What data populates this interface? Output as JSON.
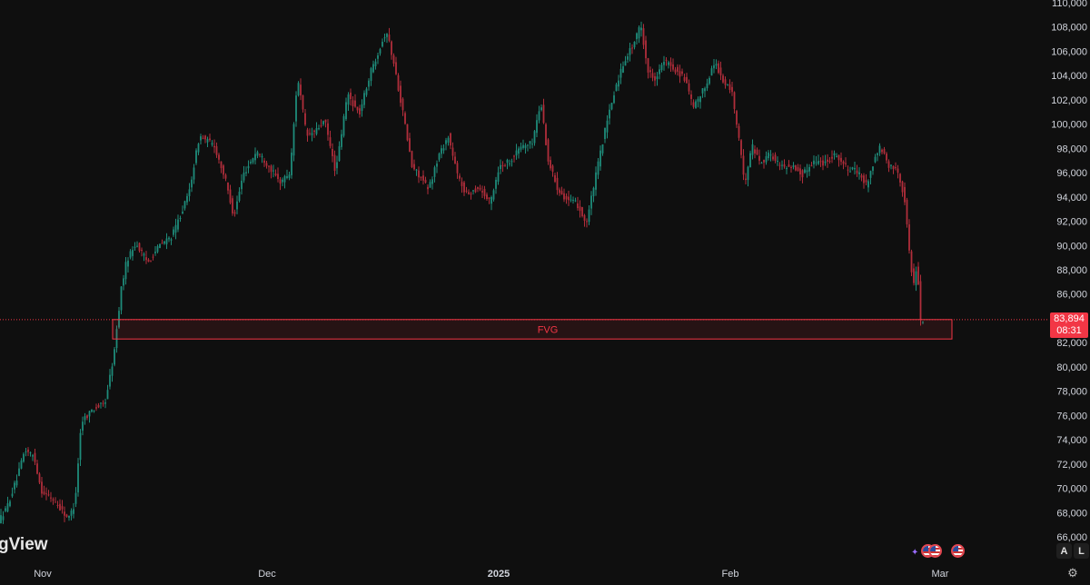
{
  "chart_data": {
    "type": "candlestick",
    "y_axis": {
      "min": 66000,
      "max": 110000,
      "ticks": [
        "110,000",
        "108,000",
        "106,000",
        "104,000",
        "102,000",
        "100,000",
        "98,000",
        "96,000",
        "94,000",
        "92,000",
        "90,000",
        "88,000",
        "86,000",
        "82,000",
        "80,000",
        "78,000",
        "76,000",
        "74,000",
        "72,000",
        "70,000",
        "68,000",
        "66,000"
      ]
    },
    "x_axis": {
      "ticks": [
        {
          "label": "Nov",
          "bold": false
        },
        {
          "label": "Dec",
          "bold": false
        },
        {
          "label": "2025",
          "bold": true
        },
        {
          "label": "Feb",
          "bold": false
        },
        {
          "label": "Mar",
          "bold": false
        }
      ]
    },
    "trend_anchors": [
      [
        0,
        67200
      ],
      [
        10,
        68400
      ],
      [
        22,
        71000
      ],
      [
        30,
        73200
      ],
      [
        40,
        72600
      ],
      [
        48,
        69800
      ],
      [
        62,
        69000
      ],
      [
        78,
        67500
      ],
      [
        85,
        68800
      ],
      [
        92,
        75500
      ],
      [
        104,
        76500
      ],
      [
        118,
        77000
      ],
      [
        128,
        81000
      ],
      [
        136,
        86500
      ],
      [
        142,
        88800
      ],
      [
        152,
        90200
      ],
      [
        165,
        88600
      ],
      [
        178,
        90000
      ],
      [
        192,
        90800
      ],
      [
        210,
        94200
      ],
      [
        222,
        99000
      ],
      [
        238,
        98300
      ],
      [
        250,
        95600
      ],
      [
        260,
        92400
      ],
      [
        270,
        95800
      ],
      [
        285,
        97800
      ],
      [
        298,
        96600
      ],
      [
        310,
        95200
      ],
      [
        322,
        96000
      ],
      [
        330,
        104000
      ],
      [
        340,
        99000
      ],
      [
        350,
        99400
      ],
      [
        360,
        100300
      ],
      [
        372,
        96000
      ],
      [
        385,
        102500
      ],
      [
        398,
        100800
      ],
      [
        410,
        104200
      ],
      [
        420,
        106200
      ],
      [
        428,
        107700
      ],
      [
        436,
        105000
      ],
      [
        446,
        101000
      ],
      [
        456,
        96500
      ],
      [
        464,
        95800
      ],
      [
        474,
        94600
      ],
      [
        486,
        97500
      ],
      [
        496,
        99000
      ],
      [
        506,
        95800
      ],
      [
        516,
        94200
      ],
      [
        530,
        94800
      ],
      [
        542,
        93500
      ],
      [
        552,
        96500
      ],
      [
        564,
        97000
      ],
      [
        576,
        98200
      ],
      [
        588,
        98400
      ],
      [
        598,
        101800
      ],
      [
        606,
        97000
      ],
      [
        616,
        94800
      ],
      [
        626,
        93800
      ],
      [
        638,
        93400
      ],
      [
        648,
        91800
      ],
      [
        658,
        95600
      ],
      [
        668,
        99300
      ],
      [
        680,
        103000
      ],
      [
        690,
        105300
      ],
      [
        700,
        106600
      ],
      [
        708,
        108200
      ],
      [
        716,
        104300
      ],
      [
        724,
        103800
      ],
      [
        734,
        105200
      ],
      [
        744,
        104600
      ],
      [
        756,
        103800
      ],
      [
        766,
        101300
      ],
      [
        778,
        103000
      ],
      [
        790,
        105200
      ],
      [
        798,
        103500
      ],
      [
        808,
        102800
      ],
      [
        816,
        98800
      ],
      [
        822,
        95000
      ],
      [
        830,
        98300
      ],
      [
        840,
        96800
      ],
      [
        850,
        97600
      ],
      [
        862,
        96500
      ],
      [
        874,
        96600
      ],
      [
        886,
        95800
      ],
      [
        898,
        97000
      ],
      [
        910,
        96800
      ],
      [
        922,
        97600
      ],
      [
        934,
        96400
      ],
      [
        946,
        96100
      ],
      [
        956,
        95000
      ],
      [
        966,
        97200
      ],
      [
        972,
        98200
      ],
      [
        980,
        96500
      ],
      [
        990,
        96400
      ],
      [
        998,
        94000
      ],
      [
        1004,
        89200
      ],
      [
        1008,
        86600
      ],
      [
        1012,
        88600
      ],
      [
        1016,
        83894
      ]
    ],
    "last_price": "83,894",
    "countdown": "08:31",
    "fvg_zone": {
      "label": "FVG",
      "low": 82300,
      "high": 83900
    },
    "colors": {
      "up": "#1f8c7a",
      "down": "#b02e3b",
      "fvg": "#f23645",
      "price_line": "#f23645",
      "background": "#0f0f0f"
    }
  },
  "watermark": "gView",
  "scale_buttons": {
    "auto": "A",
    "log": "L"
  },
  "icons": {
    "settings": "gear-icon",
    "events": "us-flag-icon"
  }
}
